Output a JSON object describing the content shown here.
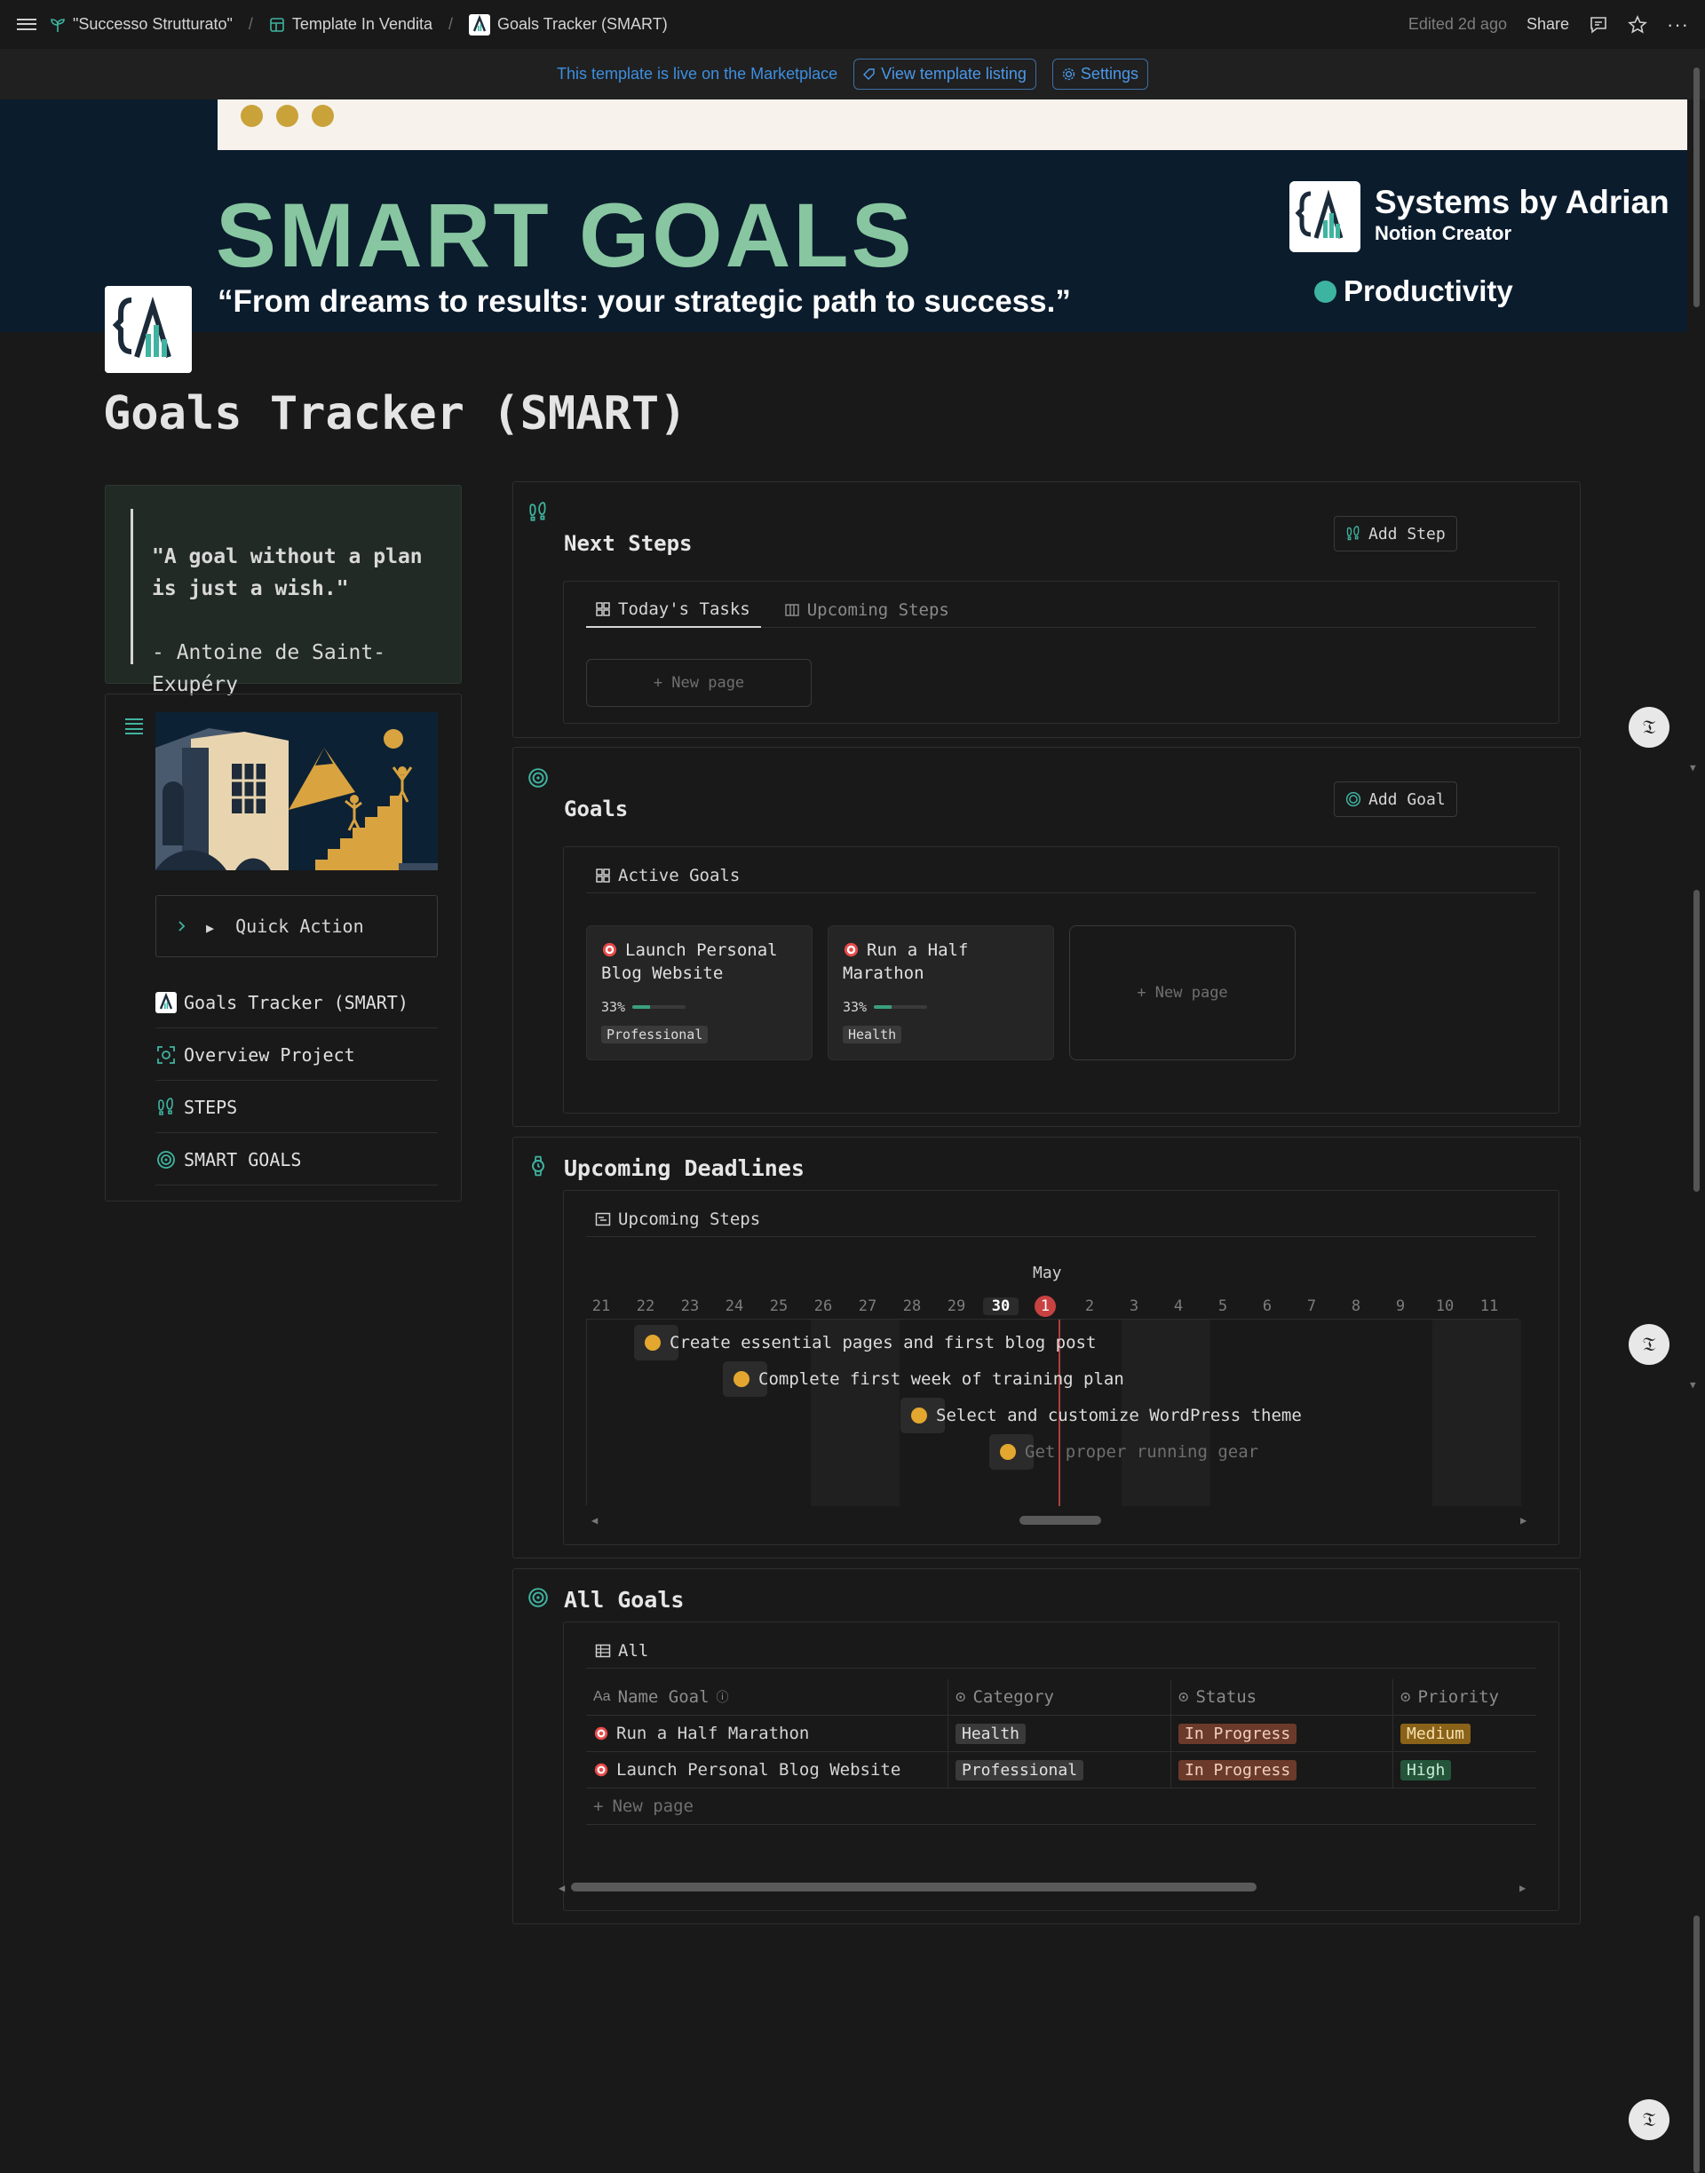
{
  "topbar": {
    "breadcrumbs": [
      {
        "label": "\"Successo Strutturato\"",
        "icon": "sprout-icon"
      },
      {
        "label": "Template In Vendita",
        "icon": "layout-icon"
      },
      {
        "label": "Goals Tracker (SMART)",
        "icon": "brand-logo-icon"
      }
    ],
    "edited": "Edited 2d ago",
    "share": "Share"
  },
  "banner": {
    "text": "This template is live on the Marketplace",
    "view_listing": "View template listing",
    "settings": "Settings"
  },
  "cover": {
    "title": "SMART GOALS",
    "subtitle": "“From dreams to results: your strategic path   to success.”",
    "brand_name": "Systems by Adrian",
    "brand_role": "Notion Creator",
    "brand_tag": "Productivity"
  },
  "page": {
    "title": "Goals Tracker (SMART)"
  },
  "quote": {
    "text": "\"A goal without a plan is just a wish.\"",
    "author": "- Antoine de Saint-Exupéry"
  },
  "nav": {
    "quick_action": "Quick Action",
    "items": [
      {
        "label": "Goals Tracker (SMART)"
      },
      {
        "label": "Overview Project"
      },
      {
        "label": "STEPS"
      },
      {
        "label": "SMART GOALS"
      }
    ]
  },
  "next_steps": {
    "title": "Next Steps",
    "add_button": "Add Step",
    "tabs": [
      "Today's Tasks",
      "Upcoming Steps"
    ],
    "new_page": "+ New page"
  },
  "goals": {
    "title": "Goals",
    "add_button": "Add Goal",
    "view": "Active Goals",
    "cards": [
      {
        "title": "Launch Personal Blog Website",
        "progress_label": "33%",
        "progress": 0.33,
        "category": "Professional"
      },
      {
        "title": "Run a Half Marathon",
        "progress_label": "33%",
        "progress": 0.33,
        "category": "Health"
      }
    ],
    "new_page": "+ New page"
  },
  "deadlines": {
    "title": "Upcoming Deadlines",
    "view": "Upcoming Steps",
    "month": "May",
    "days": [
      "21",
      "22",
      "23",
      "24",
      "25",
      "26",
      "27",
      "28",
      "29",
      "30",
      "1",
      "2",
      "3",
      "4",
      "5",
      "6",
      "7",
      "8",
      "9",
      "10",
      "11"
    ],
    "today": "1",
    "tasks": [
      "Create essential pages and first blog post",
      "Complete first week of training plan",
      "Select and customize WordPress theme",
      "Get proper running gear"
    ]
  },
  "all_goals": {
    "title": "All Goals",
    "view": "All",
    "columns": [
      "Name Goal",
      "Category",
      "Status",
      "Priority"
    ],
    "rows": [
      {
        "name": "Run a Half Marathon",
        "category": "Health",
        "status": "In Progress",
        "priority": "Medium"
      },
      {
        "name": "Launch Personal Blog Website",
        "category": "Professional",
        "status": "In Progress",
        "priority": "High"
      }
    ],
    "new_page": "New page"
  },
  "colors": {
    "accent_teal": "#3fb4a0",
    "link_blue": "#3d8fe0",
    "cover_green": "#87c6a0",
    "status_in_progress": "#6b3a2a",
    "priority_medium": "#8a6218",
    "priority_high": "#24543a"
  }
}
